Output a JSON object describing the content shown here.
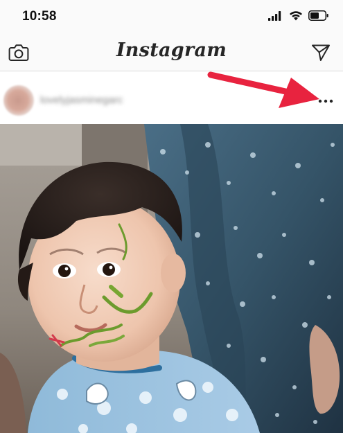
{
  "status_bar": {
    "time": "10:58",
    "icons": [
      "signal-icon",
      "wifi-icon",
      "battery-icon"
    ]
  },
  "header": {
    "title": "Instagram",
    "left_icon": "camera-icon",
    "right_icon": "direct-message-icon"
  },
  "post": {
    "username": "lovelyjasminegarc",
    "more_icon": "more-options-icon",
    "photo_icon": "post-photo"
  },
  "annotation": {
    "type": "arrow",
    "color": "#e8233f",
    "points_to": "more-options-icon"
  }
}
